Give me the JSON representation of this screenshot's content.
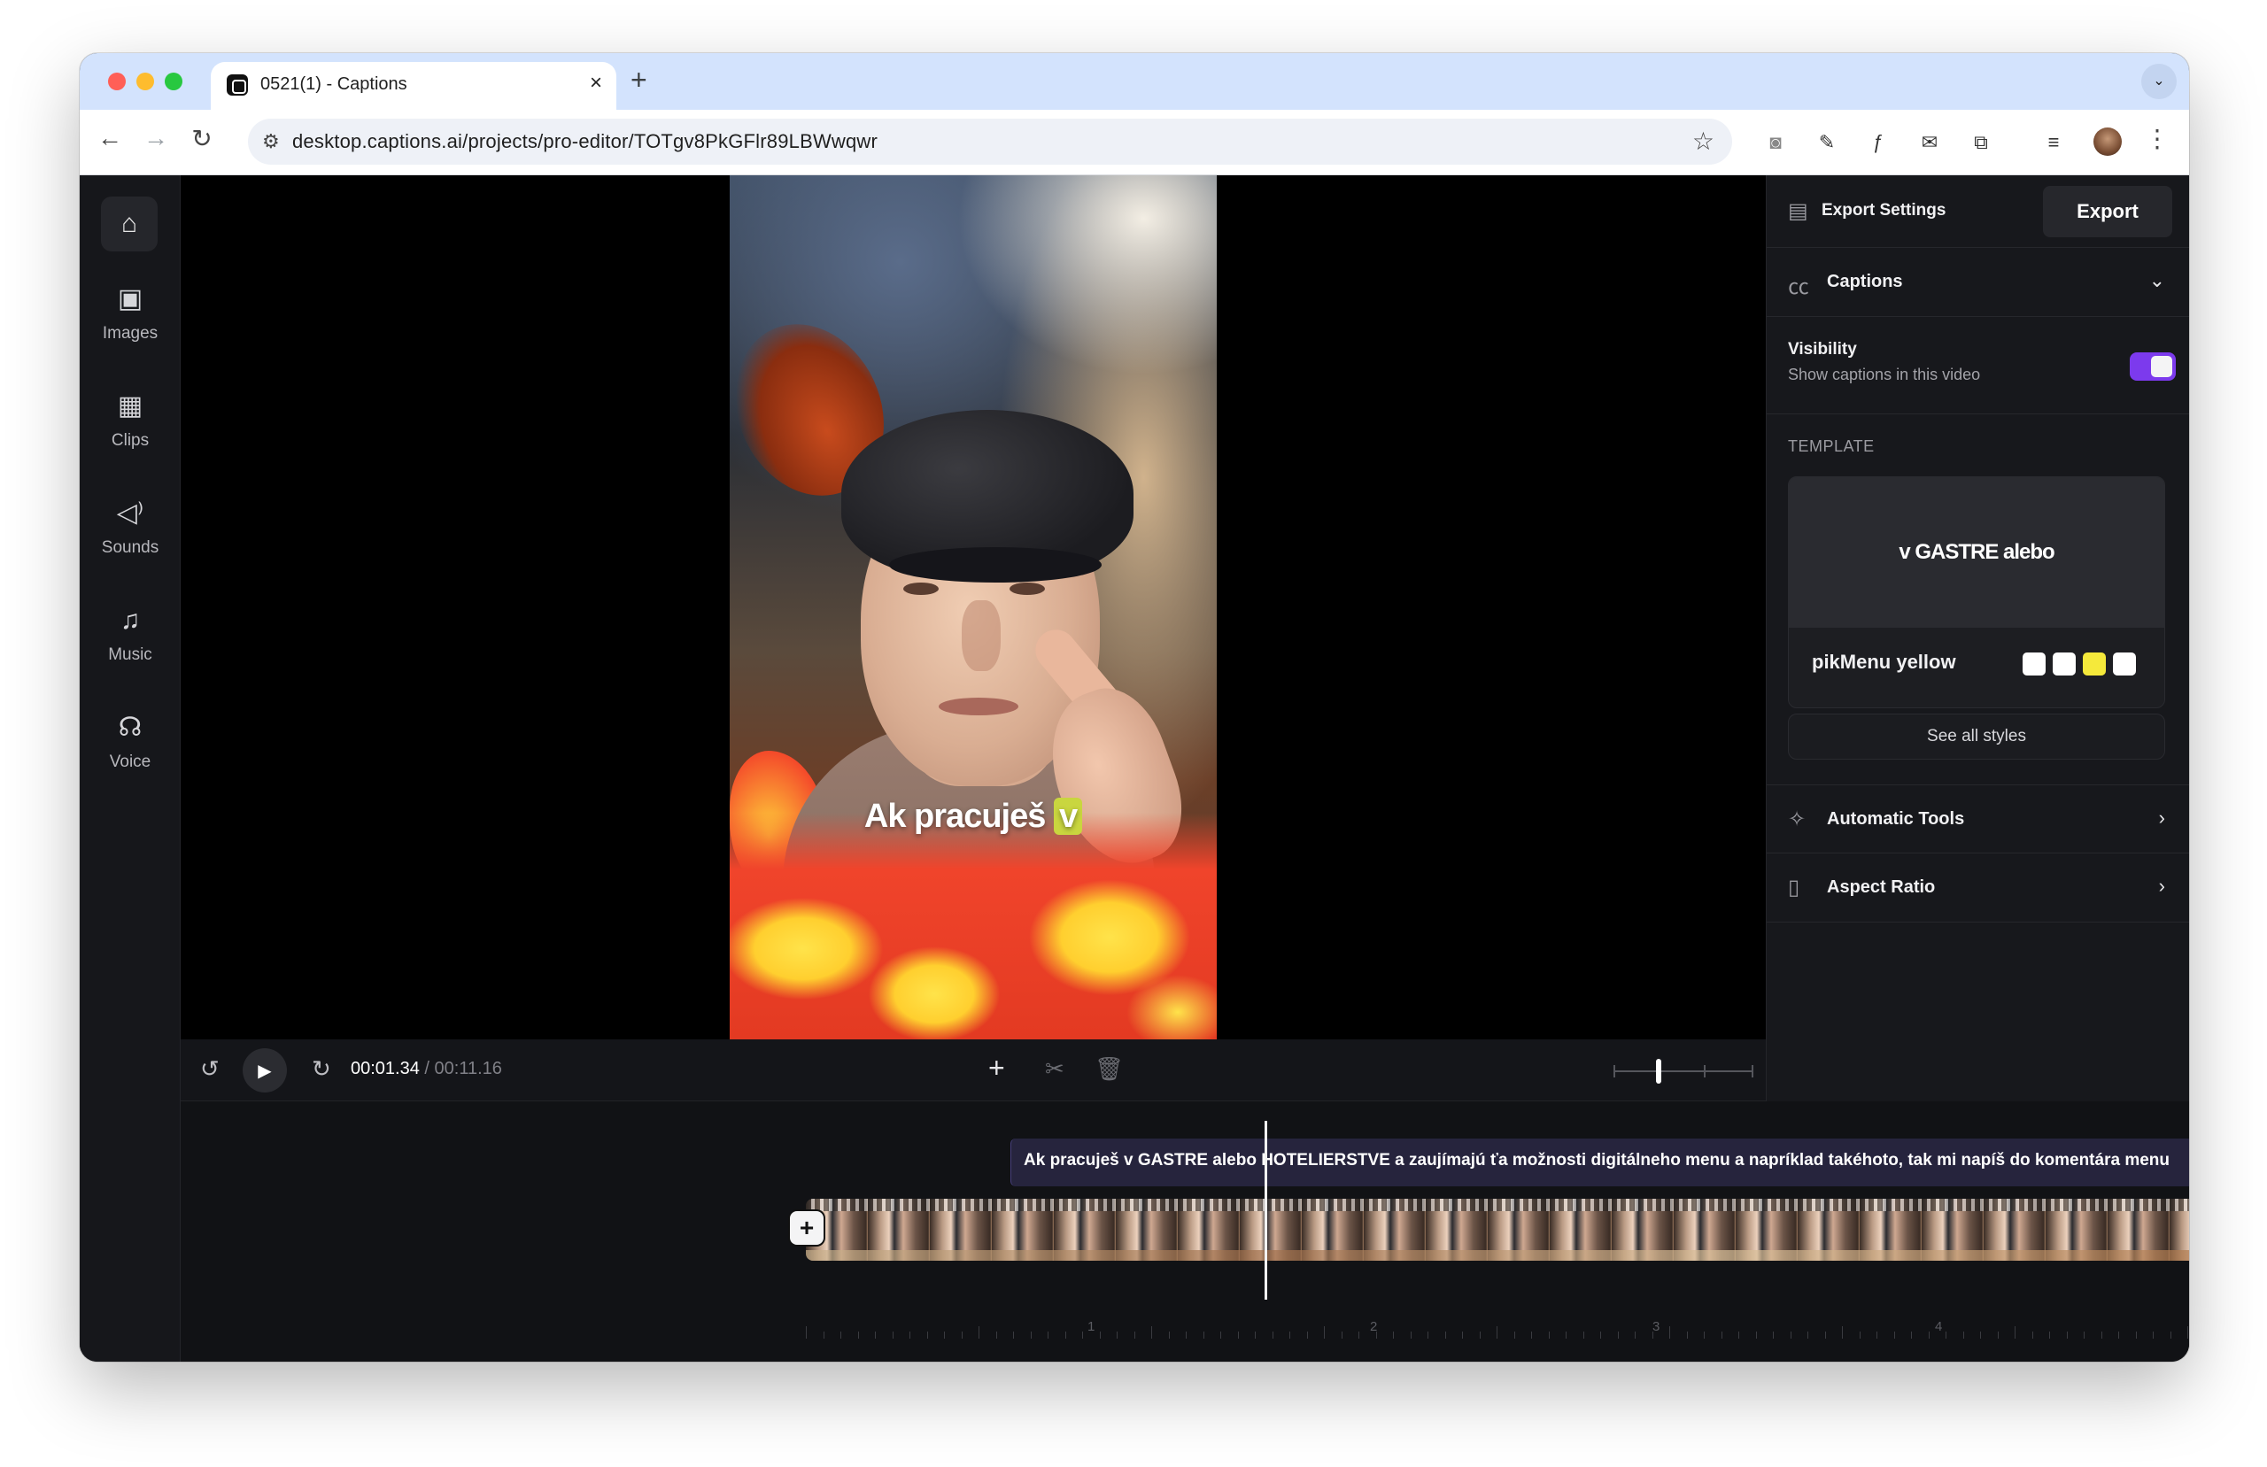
{
  "browser": {
    "tab_title": "0521(1) - Captions",
    "url": "desktop.captions.ai/projects/pro-editor/TOTgv8PkGFlr89LBWwqwr"
  },
  "sidebar": {
    "items": [
      {
        "label": "Images",
        "icon": "image-add-icon"
      },
      {
        "label": "Clips",
        "icon": "film-icon"
      },
      {
        "label": "Sounds",
        "icon": "speaker-icon"
      },
      {
        "label": "Music",
        "icon": "music-note-icon"
      },
      {
        "label": "Voice",
        "icon": "voice-icon"
      }
    ]
  },
  "video": {
    "caption_main": "Ak pracuješ",
    "caption_highlight": "v"
  },
  "playback": {
    "current_time": "00:01.34",
    "separator": " / ",
    "total_time": "00:11.16",
    "zoom_level": 0.3
  },
  "timeline": {
    "caption_text": "Ak pracuješ v GASTRE alebo HOTELIERSTVE a zaujímajú ťa možnosti digitálneho menu a napríklad takéhoto, tak mi napíš do komentára menu",
    "ruler_labels": [
      "1",
      "2",
      "3",
      "4"
    ]
  },
  "panel": {
    "export_settings": "Export Settings",
    "export_button": "Export",
    "captions_section": "Captions",
    "visibility_title": "Visibility",
    "visibility_sub": "Show captions in this video",
    "visibility_on": true,
    "template_heading": "TEMPLATE",
    "template_preview_text": "v GASTRE alebo",
    "template_name": "pikMenu yellow",
    "swatch_colors": [
      "#ffffff",
      "#ffffff",
      "#f5e93b",
      "#ffffff"
    ],
    "see_all": "See all styles",
    "automatic_tools": "Automatic Tools",
    "aspect_ratio": "Aspect Ratio"
  },
  "colors": {
    "accent": "#7c3aed",
    "caption_highlight": "#c9d63f",
    "caption_track": "#26243d"
  }
}
